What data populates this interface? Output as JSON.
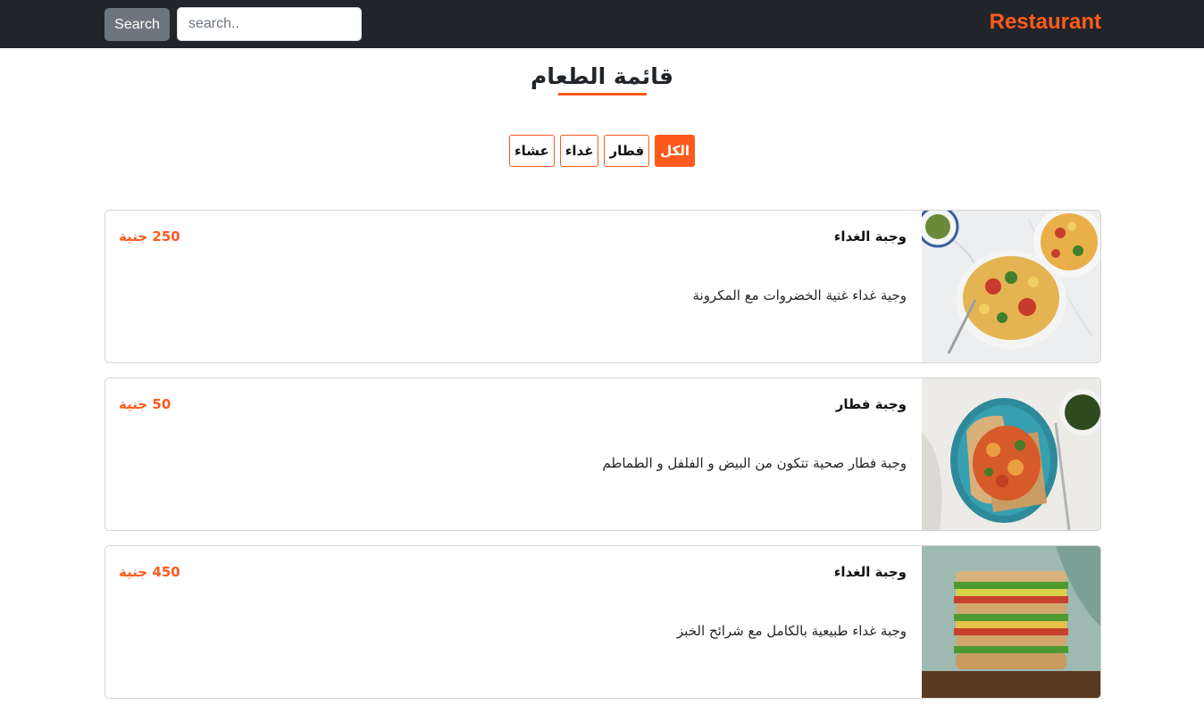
{
  "navbar": {
    "search_button_label": "Search",
    "search_placeholder": "search..",
    "brand": "Restaurant"
  },
  "page": {
    "title": "قائمة الطعام"
  },
  "filters": [
    {
      "label": "الكل",
      "active": true
    },
    {
      "label": "فطار",
      "active": false
    },
    {
      "label": "غداء",
      "active": false
    },
    {
      "label": "عشاء",
      "active": false
    }
  ],
  "menu_items": [
    {
      "title": "وجبة الغداء",
      "price": "250 جنية",
      "description": "وجية غداء غنية الخضروات مع المكرونة",
      "image": "pasta-salad-bowl"
    },
    {
      "title": "وجبة فطار",
      "price": "50 جنية",
      "description": "وجبة فطار صحية تتكون من البيض و الفلفل و الطماطم",
      "image": "eggs-on-toast-plate"
    },
    {
      "title": "وجبة الغداء",
      "price": "450 جنية",
      "description": "وجبة غداء طبيعية بالكامل مع شرائح الخبز",
      "image": "stacked-sandwich"
    }
  ],
  "colors": {
    "accent": "#fe5a1d",
    "navbar_bg": "#212529",
    "button_secondary": "#6c757d"
  }
}
